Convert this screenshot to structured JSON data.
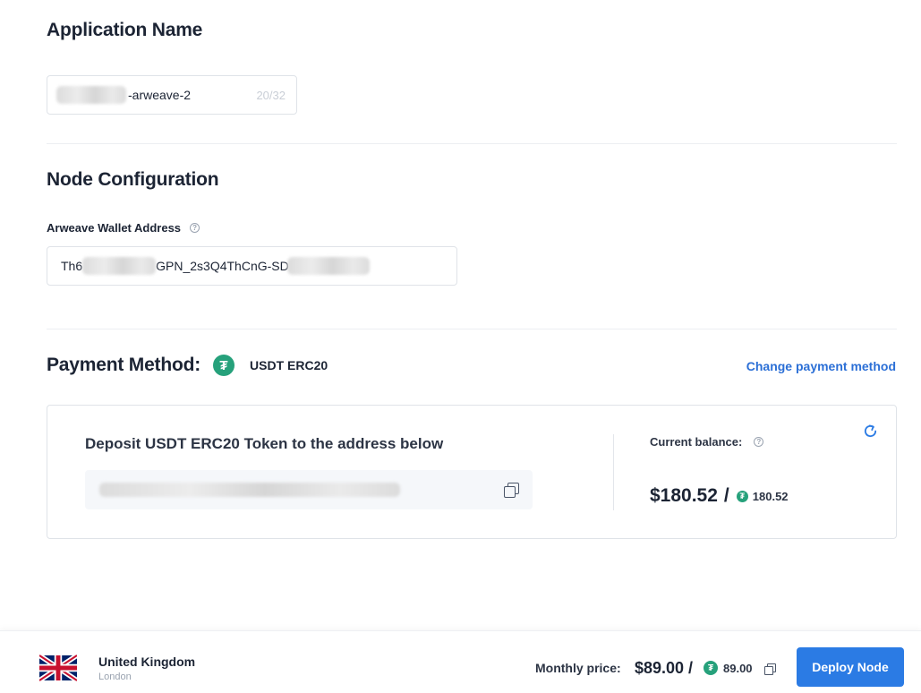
{
  "application": {
    "title": "Application Name",
    "name_value": "-arweave-2",
    "char_count": "20/32"
  },
  "node_config": {
    "title": "Node Configuration",
    "wallet_label": "Arweave Wallet Address",
    "wallet_prefix": "Th6",
    "wallet_middle": "GPN_2s3Q4ThCnG-SD"
  },
  "payment": {
    "title": "Payment Method:",
    "method_name": "USDT ERC20",
    "change_link": "Change payment method",
    "deposit_title": "Deposit USDT ERC20 Token to the address below",
    "balance_label": "Current balance:",
    "balance_usd": "$180.52",
    "balance_slash": "/",
    "balance_token": "180.52",
    "token_icon": "tether-icon",
    "token_color": "#26a17b"
  },
  "footer": {
    "country": "United Kingdom",
    "city": "London",
    "price_label": "Monthly price:",
    "price_usd": "$89.00 /",
    "price_token": "89.00",
    "deploy_label": "Deploy Node",
    "accent": "#2b7be4"
  }
}
